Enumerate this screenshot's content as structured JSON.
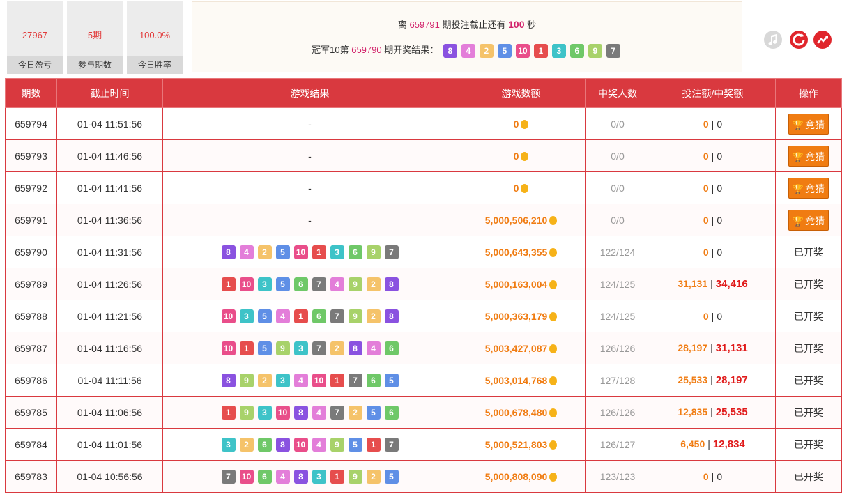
{
  "stats": [
    {
      "value": "27967",
      "label": "今日盈亏"
    },
    {
      "value": "5期",
      "label": "参与期数"
    },
    {
      "value": "100.0%",
      "label": "今日胜率"
    }
  ],
  "info": {
    "line1_prefix": "离",
    "line1_period": "659791",
    "line1_mid": "期投注截止还有",
    "line1_seconds": "100",
    "line1_suffix": "秒",
    "line2_prefix": "冠军10第",
    "line2_period": "659790",
    "line2_suffix": "期开奖结果：",
    "balls": [
      8,
      4,
      2,
      5,
      10,
      1,
      3,
      6,
      9,
      7
    ]
  },
  "icons": {
    "music": "music-icon",
    "refresh": "refresh-icon",
    "trend": "trend-icon"
  },
  "ball_colors": {
    "1": "#e64d4d",
    "2": "#f5c36a",
    "3": "#3ec3c8",
    "4": "#e37ed9",
    "5": "#5f8fe6",
    "6": "#6fc868",
    "7": "#7a7a7a",
    "8": "#8a52e0",
    "9": "#a8d26a",
    "10": "#e94e8a"
  },
  "table": {
    "headers": [
      "期数",
      "截止时间",
      "游戏结果",
      "游戏数额",
      "中奖人数",
      "投注额/中奖额",
      "操作"
    ],
    "rows": [
      {
        "period": "659794",
        "time": "01-04 11:51:56",
        "result": "-",
        "balls": [],
        "amount": "0",
        "winners": "0/0",
        "bet": "0",
        "win": "0",
        "action": "竞猜",
        "open": true
      },
      {
        "period": "659793",
        "time": "01-04 11:46:56",
        "result": "-",
        "balls": [],
        "amount": "0",
        "winners": "0/0",
        "bet": "0",
        "win": "0",
        "action": "竞猜",
        "open": true
      },
      {
        "period": "659792",
        "time": "01-04 11:41:56",
        "result": "-",
        "balls": [],
        "amount": "0",
        "winners": "0/0",
        "bet": "0",
        "win": "0",
        "action": "竞猜",
        "open": true
      },
      {
        "period": "659791",
        "time": "01-04 11:36:56",
        "result": "-",
        "balls": [],
        "amount": "5,000,506,210",
        "winners": "0/0",
        "bet": "0",
        "win": "0",
        "action": "竞猜",
        "open": true
      },
      {
        "period": "659790",
        "time": "01-04 11:31:56",
        "result": "",
        "balls": [
          8,
          4,
          2,
          5,
          10,
          1,
          3,
          6,
          9,
          7
        ],
        "amount": "5,000,643,355",
        "winners": "122/124",
        "bet": "0",
        "win": "0",
        "action": "已开奖",
        "open": false
      },
      {
        "period": "659789",
        "time": "01-04 11:26:56",
        "result": "",
        "balls": [
          1,
          10,
          3,
          5,
          6,
          7,
          4,
          9,
          2,
          8
        ],
        "amount": "5,000,163,004",
        "winners": "124/125",
        "bet": "31,131",
        "win": "34,416",
        "action": "已开奖",
        "open": false
      },
      {
        "period": "659788",
        "time": "01-04 11:21:56",
        "result": "",
        "balls": [
          10,
          3,
          5,
          4,
          1,
          6,
          7,
          9,
          2,
          8
        ],
        "amount": "5,000,363,179",
        "winners": "124/125",
        "bet": "0",
        "win": "0",
        "action": "已开奖",
        "open": false
      },
      {
        "period": "659787",
        "time": "01-04 11:16:56",
        "result": "",
        "balls": [
          10,
          1,
          5,
          9,
          3,
          7,
          2,
          8,
          4,
          6
        ],
        "amount": "5,003,427,087",
        "winners": "126/126",
        "bet": "28,197",
        "win": "31,131",
        "action": "已开奖",
        "open": false
      },
      {
        "period": "659786",
        "time": "01-04 11:11:56",
        "result": "",
        "balls": [
          8,
          9,
          2,
          3,
          4,
          10,
          1,
          7,
          6,
          5
        ],
        "amount": "5,003,014,768",
        "winners": "127/128",
        "bet": "25,533",
        "win": "28,197",
        "action": "已开奖",
        "open": false
      },
      {
        "period": "659785",
        "time": "01-04 11:06:56",
        "result": "",
        "balls": [
          1,
          9,
          3,
          10,
          8,
          4,
          7,
          2,
          5,
          6
        ],
        "amount": "5,000,678,480",
        "winners": "126/126",
        "bet": "12,835",
        "win": "25,535",
        "action": "已开奖",
        "open": false
      },
      {
        "period": "659784",
        "time": "01-04 11:01:56",
        "result": "",
        "balls": [
          3,
          2,
          6,
          8,
          10,
          4,
          9,
          5,
          1,
          7
        ],
        "amount": "5,000,521,803",
        "winners": "126/127",
        "bet": "6,450",
        "win": "12,834",
        "action": "已开奖",
        "open": false
      },
      {
        "period": "659783",
        "time": "01-04 10:56:56",
        "result": "",
        "balls": [
          7,
          10,
          6,
          4,
          8,
          3,
          1,
          9,
          2,
          5
        ],
        "amount": "5,000,808,090",
        "winners": "123/123",
        "bet": "0",
        "win": "0",
        "action": "已开奖",
        "open": false
      }
    ]
  }
}
